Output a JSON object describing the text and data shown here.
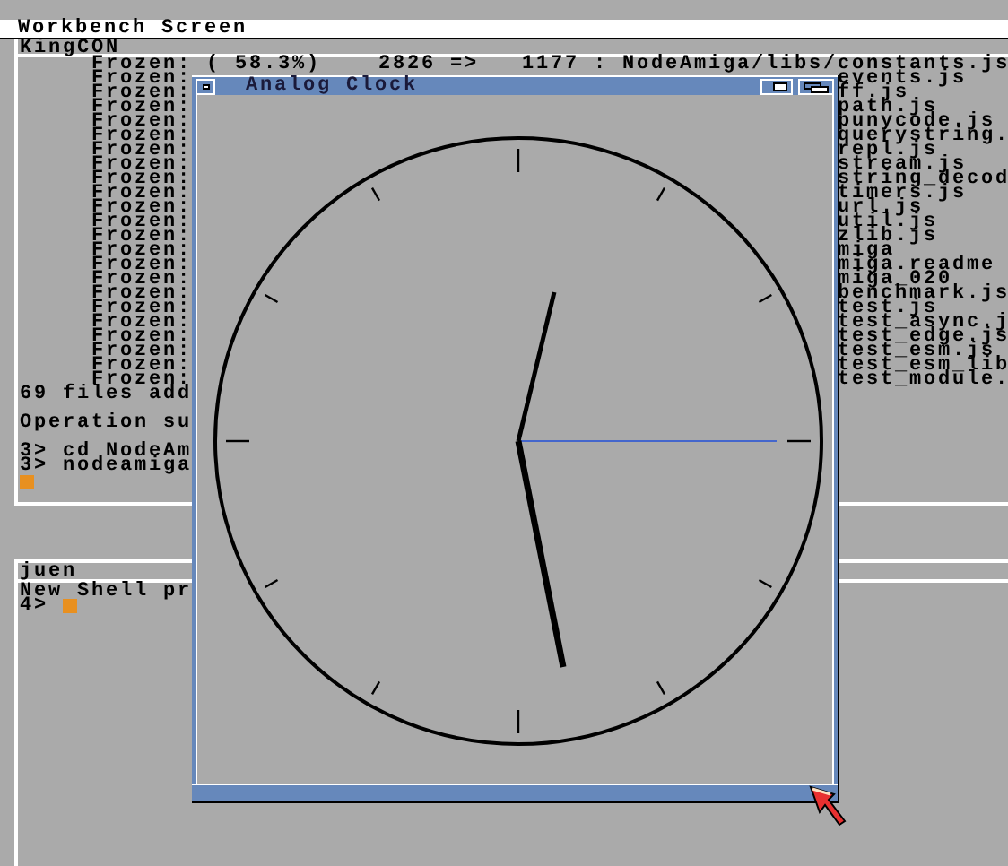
{
  "screen_title": "Workbench Screen",
  "console": {
    "title": "KingCON",
    "first_line": "Frozen: ( 58.3%)    2826 =>   1177 : NodeAmiga/libs/constants.js",
    "lines": [
      {
        "left": "Frozen:",
        "right": "events.js"
      },
      {
        "left": "Frozen:",
        "right": "ff.js"
      },
      {
        "left": "Frozen:",
        "right": "path.js"
      },
      {
        "left": "Frozen:",
        "right": "punycode.js"
      },
      {
        "left": "Frozen:",
        "right": "querystring."
      },
      {
        "left": "Frozen:",
        "right": "repl.js"
      },
      {
        "left": "Frozen:",
        "right": "stream.js"
      },
      {
        "left": "Frozen:",
        "right": "string_decod"
      },
      {
        "left": "Frozen:",
        "right": "timers.js"
      },
      {
        "left": "Frozen:",
        "right": "url.js"
      },
      {
        "left": "Frozen:",
        "right": "util.js"
      },
      {
        "left": "Frozen:",
        "right": "zlib.js"
      },
      {
        "left": "Frozen:",
        "right": "miga"
      },
      {
        "left": "Frozen:",
        "right": "miga.readme"
      },
      {
        "left": "Frozen:",
        "right": "miga_020"
      },
      {
        "left": "Frozen:",
        "right": "benchmark.js"
      },
      {
        "left": "Frozen:",
        "right": "test.js"
      },
      {
        "left": "Frozen:",
        "right": "test_async.j"
      },
      {
        "left": "Frozen:",
        "right": "test_edge.js"
      },
      {
        "left": "Frozen:",
        "right": "test_esm.js"
      },
      {
        "left": "Frozen:",
        "right": "test_esm_lib"
      },
      {
        "left": "Frozen:",
        "right": "test_module."
      }
    ],
    "tail": [
      {
        "kind": "message",
        "text": "69 files add"
      },
      {
        "kind": "message",
        "text": "Operation su"
      },
      {
        "kind": "command",
        "text": "3> cd NodeAm"
      },
      {
        "kind": "command",
        "text": "3> nodeamiga"
      }
    ],
    "cursor": true
  },
  "shell": {
    "title": "juen",
    "lines": [
      "New Shell pr"
    ],
    "prompt": "4>",
    "cursor": true
  },
  "clock": {
    "title": "Analog Clock"
  }
}
